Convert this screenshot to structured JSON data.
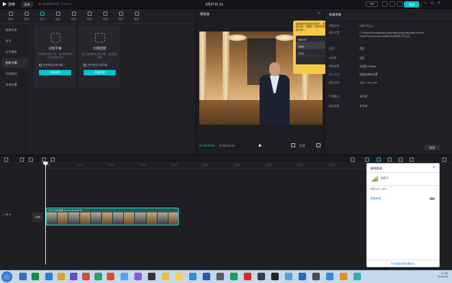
{
  "titlebar": {
    "app_name": "剪映",
    "menu_label": "菜单",
    "autosave": "自动保存本地: 17:05:34",
    "doc_title": "6月27日 (1)",
    "vip_label": "VIP",
    "export_label": "导出"
  },
  "toolbar": {
    "items": [
      {
        "label": "媒体",
        "icon": "media-icon"
      },
      {
        "label": "音频",
        "icon": "audio-icon"
      },
      {
        "label": "文本",
        "icon": "text-icon"
      },
      {
        "label": "贴纸",
        "icon": "sticker-icon"
      },
      {
        "label": "特效",
        "icon": "effects-icon"
      },
      {
        "label": "转场",
        "icon": "transition-icon"
      },
      {
        "label": "滤镜",
        "icon": "filter-icon"
      },
      {
        "label": "调节",
        "icon": "adjust-icon"
      },
      {
        "label": "模板",
        "icon": "template-icon"
      }
    ],
    "active_index": 2
  },
  "sidenav": {
    "items": [
      "新建文本",
      "花字",
      "文字模板",
      "智能字幕",
      "识别歌词",
      "本地字幕"
    ],
    "active_index": 3
  },
  "cards": [
    {
      "title": "识别字幕",
      "desc": "识别音轨中的人声，自动在时间线上生成字幕文本",
      "check": "同时清空已有字幕",
      "button": "开始识别"
    },
    {
      "title": "文稿匹配",
      "desc": "输入音视频对应的文稿，自动匹配画面",
      "check": "同时清空已有字幕",
      "button": "开始匹配"
    }
  ],
  "player": {
    "title": "播放器",
    "time_current": "00:00:00:00",
    "time_total": "00:06:51:09",
    "ratio_label": "比例"
  },
  "tooltip": {
    "text": "新版曲线变速体验更好，支持开启「智能补帧」功能和「变声变调」，节省你的时间～",
    "menu": [
      "智能补帧",
      "帧融合",
      "光流法"
    ],
    "button": "知道了"
  },
  "props": {
    "title": "草稿参数",
    "rows": [
      {
        "label": "草稿名称:",
        "value": "6月27日 (1)"
      },
      {
        "label": "保存位置:",
        "value": "C:/Users/Administrator/AppData/Local/JianyingPro/User Data/Projects/com.lveditor.draft/6月27日 (1)"
      },
      {
        "label": "比例:",
        "value": "适应"
      },
      {
        "label": "分辨率:",
        "value": "适应"
      },
      {
        "label": "草稿帧率:",
        "value": "自适应 (30fps)"
      },
      {
        "label": "导入方式:",
        "value": "保留在原有位置"
      },
      {
        "label": "颜色空间:",
        "value": "SDR - Rec.709"
      },
      {
        "label": "代理模式:",
        "value": "未开启"
      },
      {
        "label": "自由层级:",
        "value": "未开启"
      }
    ],
    "edit_button": "修改"
  },
  "timeline": {
    "ticks": [
      "00:00",
      "|00:10",
      "|00:20",
      "|00:30",
      "|00:40",
      "|00:50",
      "|01:00",
      "|01:10",
      "|01:20",
      "|01:30"
    ],
    "cover_label": "封面",
    "clip_label": "7月1日 采访视频 (1).mp4  00:06:51:09"
  },
  "speed_panel": {
    "title": "曲线变速",
    "option": "自定义",
    "value_label": "时长 01 / 10%",
    "link": "智能补帧",
    "footer": "打开智能补帧设置中心"
  },
  "taskbar": {
    "clock_time": "17:05",
    "clock_date": "2023/7/6"
  },
  "colors": {
    "accent": "#0bc2cf",
    "tooltip": "#f6c945",
    "clip": "#1f5e5a"
  }
}
